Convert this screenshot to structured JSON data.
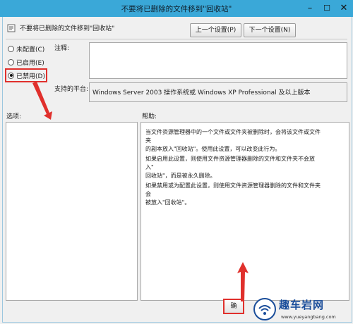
{
  "window": {
    "title": "不要将已删除的文件移到\"回收站\""
  },
  "policy": {
    "name": "不要将已删除的文件移到\"回收站\""
  },
  "nav": {
    "prev_label": "上一个设置(P)",
    "next_label": "下一个设置(N)"
  },
  "state_options": [
    {
      "label": "未配置(C)",
      "checked": false
    },
    {
      "label": "已启用(E)",
      "checked": false
    },
    {
      "label": "已禁用(D)",
      "checked": true
    }
  ],
  "comment": {
    "label": "注释:",
    "value": ""
  },
  "platform": {
    "label": "支持的平台:",
    "value": "Windows Server 2003 操作系统或 Windows XP Professional 及以上版本"
  },
  "options": {
    "label": "选项:"
  },
  "help": {
    "label": "帮助:",
    "paragraphs": [
      [
        "当文件资源管理器中的一个文件或文件夹被删除时，会将该文件或文件夹",
        "的副本放入\"回收站\"。使用此设置，可以改变此行为。"
      ],
      [
        "如果启用此设置，则使用文件资源管理器删除的文件和文件夹不会放入\"",
        "回收站\"，而是被永久删除。"
      ],
      [
        "如果禁用或为配置此设置，则使用文件资源管理器删除的文件和文件夹会",
        "被放入\"回收站\"。"
      ]
    ]
  },
  "buttons": {
    "ok_label": "确"
  },
  "watermark": {
    "text": "趣车岩网",
    "url": "www.yueyangbang.com"
  },
  "colors": {
    "titlebar": "#3aa8d8",
    "annotation": "#e0302c"
  }
}
